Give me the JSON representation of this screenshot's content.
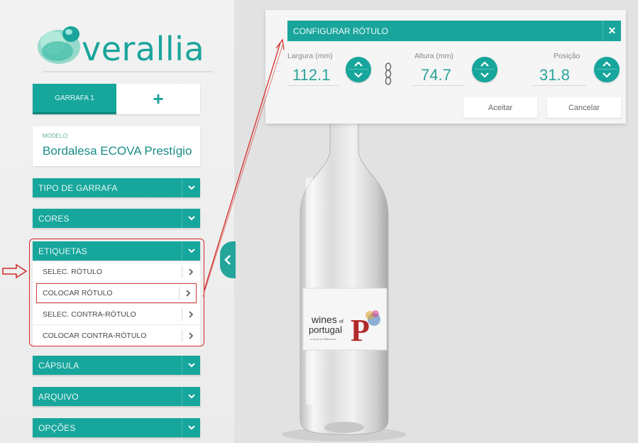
{
  "brand": {
    "name": "verallia"
  },
  "bottle_tabs": {
    "active": "GARRAFA 1",
    "add": "+"
  },
  "model": {
    "label": "MODELO:",
    "name": "Bordalesa ECOVA Prestígio"
  },
  "menu": {
    "tipo": "TIPO DE GARRAFA",
    "cores": "CORES",
    "etiquetas": "ETIQUETAS",
    "capsula": "CÁPSULA",
    "arquivo": "ARQUIVO",
    "opcoes": "OPÇÕES",
    "chevron": "❯"
  },
  "etiquetas_items": [
    {
      "label": "SELEC. RÓTULO"
    },
    {
      "label": "COLOCAR RÓTULO"
    },
    {
      "label": "SELEC. CONTRA-RÓTULO"
    },
    {
      "label": "COLOCAR CONTRA-RÓTULO"
    }
  ],
  "dialog": {
    "title": "CONFIGURAR RÓTULO",
    "close": "✕",
    "largura_label": "Largura (mm)",
    "largura_value": "112.1",
    "altura_label": "Altura (mm)",
    "altura_value": "74.7",
    "posicao_label": "Posição",
    "posicao_value": "31.8",
    "accept": "Aceitar",
    "cancel": "Cancelar"
  },
  "label_art": {
    "line1": "wines",
    "of": "of",
    "line2": "portugal",
    "tagline": "a world of difference",
    "letter": "P"
  },
  "icons": {
    "collapse": "chevron-left-icon",
    "link": "chain-link-icon",
    "pointer": "hollow-arrow-icon",
    "close": "close-icon"
  },
  "colors": {
    "accent": "#17a69c",
    "annotation": "#d42a2a"
  }
}
